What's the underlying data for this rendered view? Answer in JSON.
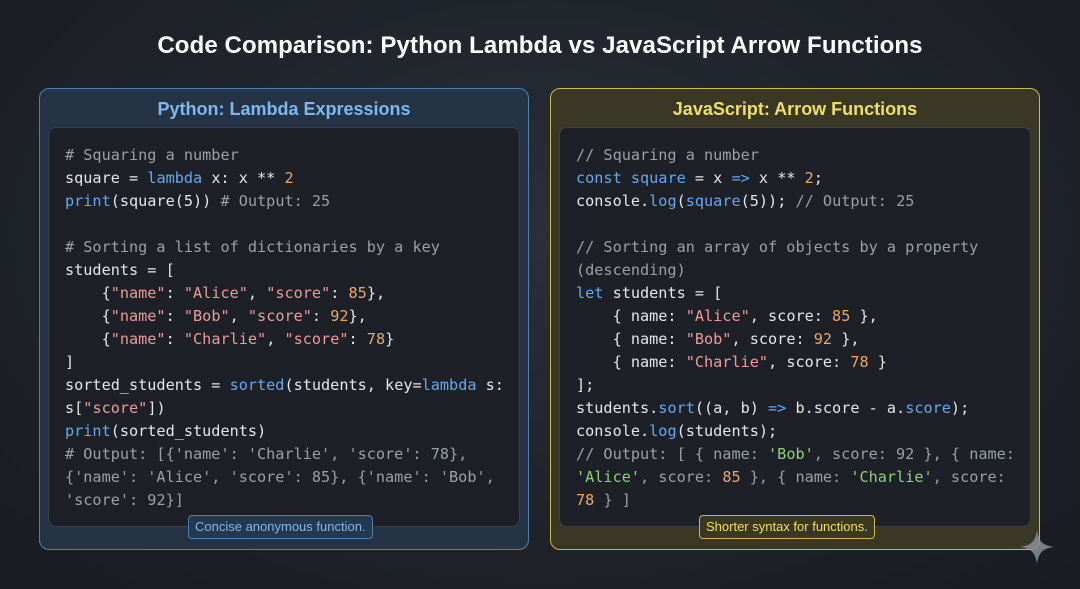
{
  "title": "Code Comparison: Python Lambda vs JavaScript Arrow Functions",
  "python": {
    "heading": "Python: Lambda Expressions",
    "caption": "Concise anonymous function.",
    "lines": [
      "# Squaring a number",
      "square = lambda x: x ** 2",
      "print(square(5)) # Output: 25",
      "",
      "# Sorting a list of dictionaries by a key",
      "students = [",
      "    {\"name\": \"Alice\", \"score\": 85},",
      "    {\"name\": \"Bob\", \"score\": 92},",
      "    {\"name\": \"Charlie\", \"score\": 78}",
      "]",
      "sorted_students = sorted(students, key=lambda s:",
      "s[\"score\"])",
      "print(sorted_students)",
      "# Output: [{'name': 'Charlie', 'score': 78},",
      "{'name': 'Alice', 'score': 85}, {'name': 'Bob',",
      "'score': 92}]"
    ]
  },
  "javascript": {
    "heading": "JavaScript: Arrow Functions",
    "caption": "Shorter syntax for functions.",
    "lines": [
      "// Squaring a number",
      "const square = x => x ** 2;",
      "console.log(square(5)); // Output: 25",
      "",
      "// Sorting an array of objects by a property",
      "(descending)",
      "let students = [",
      "    { name: \"Alice\", score: 85 },",
      "    { name: \"Bob\", score: 92 },",
      "    { name: \"Charlie\", score: 78 }",
      "];",
      "students.sort((a, b) => b.score - a.score);",
      "console.log(students);",
      "// Output: [ { name: 'Bob', score: 92 }, { name:",
      "'Alice', score: 85 }, { name: 'Charlie', score:",
      "78 } ]"
    ]
  },
  "colors": {
    "python_accent": "#7fb7ee",
    "javascript_accent": "#f1de68",
    "comment": "#9aa0a8",
    "keyword": "#66a8ee",
    "number": "#e8a86a"
  },
  "icons": [
    "sparkle-icon"
  ]
}
